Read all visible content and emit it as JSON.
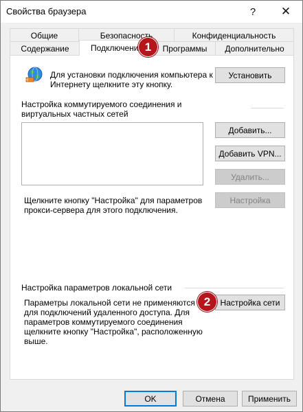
{
  "window": {
    "title": "Свойства браузера",
    "help_glyph": "?",
    "close_glyph": "✕"
  },
  "tabs_row1": [
    "Общие",
    "Безопасность",
    "Конфиденциальность"
  ],
  "tabs_row2": [
    "Содержание",
    "Подключения",
    "Программы",
    "Дополнительно"
  ],
  "active_tab": "Подключения",
  "connect": {
    "text": "Для установки подключения компьютера к Интернету щелкните эту кнопку.",
    "button": "Установить",
    "icon": "globe-network-icon"
  },
  "dialup": {
    "heading": "Настройка коммутируемого соединения и виртуальных частных сетей",
    "add_button": "Добавить...",
    "add_vpn_button": "Добавить VPN...",
    "remove_button": "Удалить...",
    "settings_hint": "Щелкните кнопку \"Настройка\" для параметров прокси-сервера для этого подключения.",
    "settings_button": "Настройка"
  },
  "lan": {
    "heading": "Настройка параметров локальной сети",
    "text": "Параметры локальной сети не применяются для подключений удаленного доступа. Для параметров коммутируемого соединения щелкните кнопку \"Настройка\", расположенную выше.",
    "button": "Настройка сети"
  },
  "footer": {
    "ok": "OK",
    "cancel": "Отмена",
    "apply": "Применить"
  },
  "markers": [
    "1",
    "2"
  ],
  "colors": {
    "marker": "#b4161b",
    "focus": "#0078d7"
  }
}
